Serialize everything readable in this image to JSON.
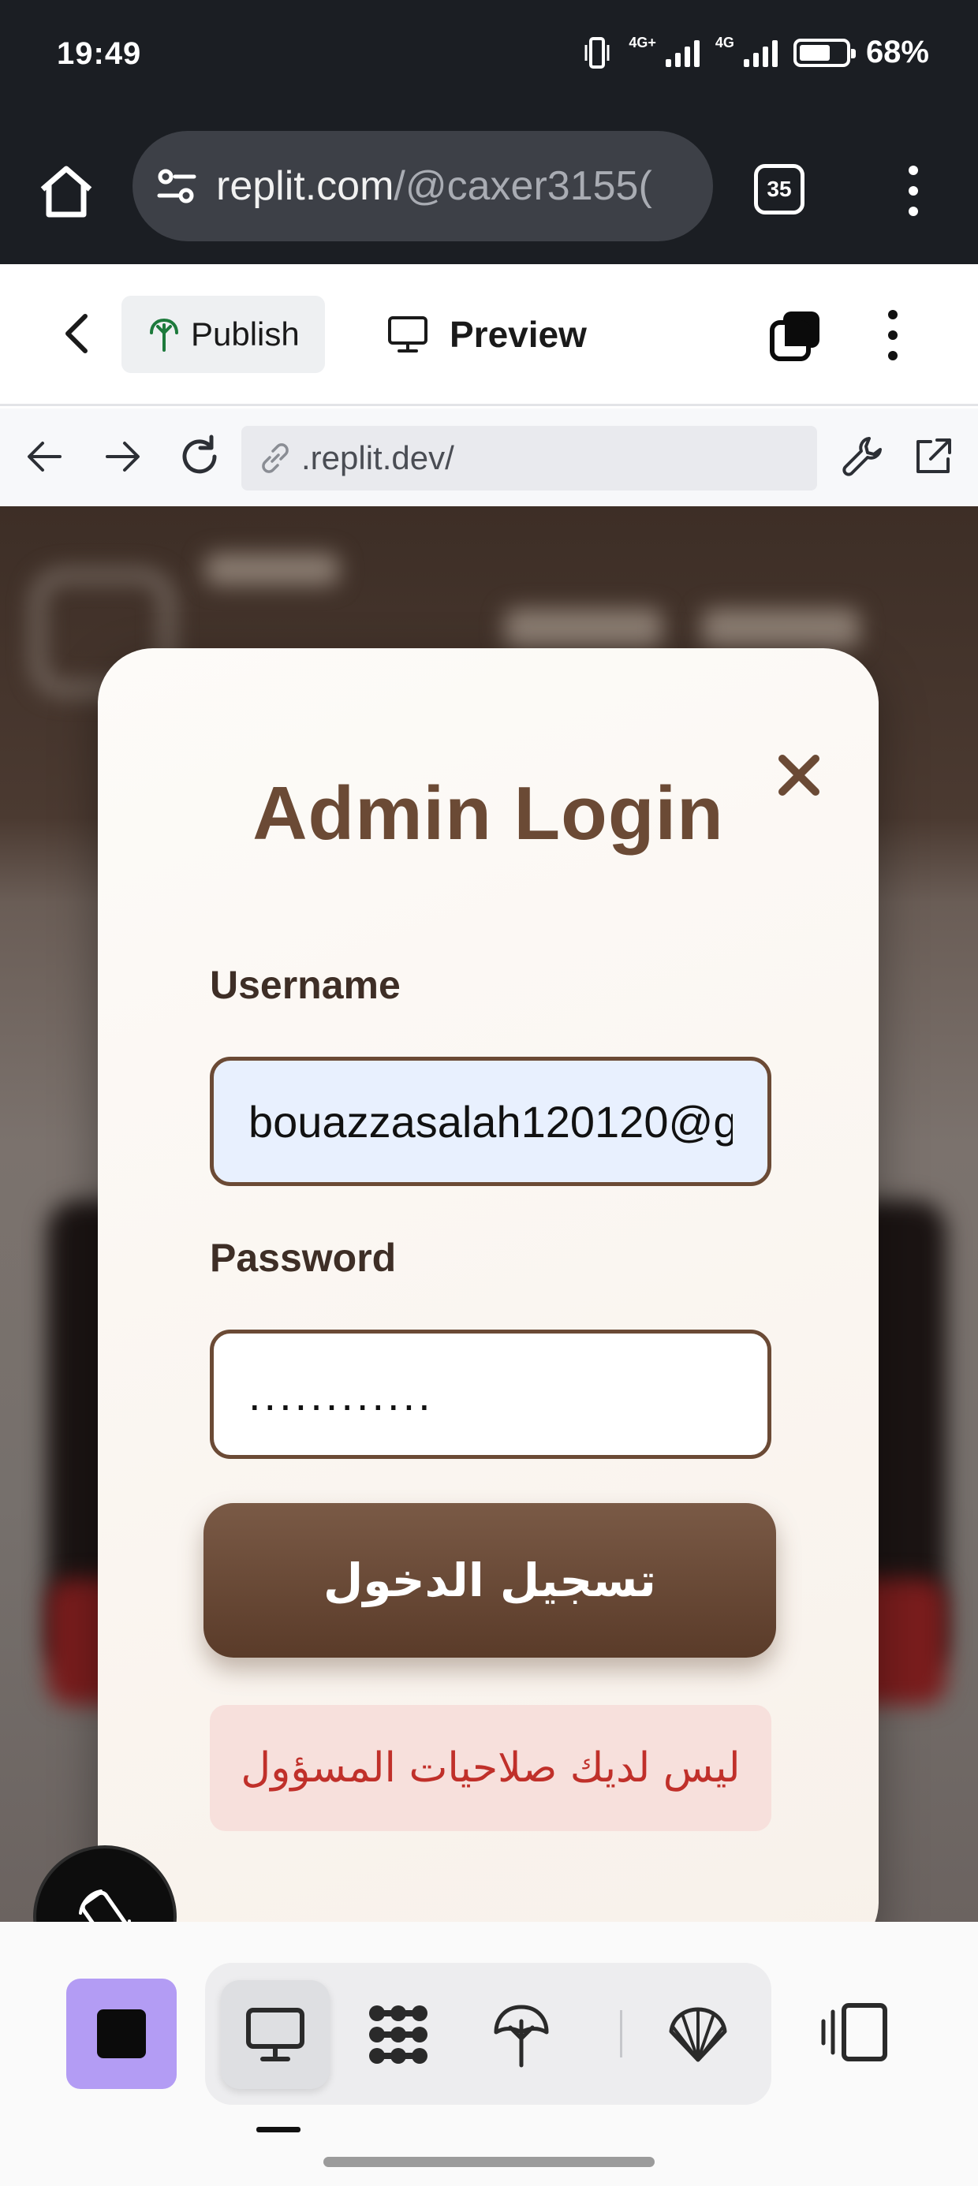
{
  "status_bar": {
    "time": "19:49",
    "network_1": "4G+",
    "network_2": "4G",
    "battery": "68%",
    "battery_level": 0.68
  },
  "browser": {
    "url_host": "replit.com",
    "url_path": "/@caxer3155(",
    "tab_count": "35"
  },
  "replit_toolbar": {
    "publish_label": "Publish",
    "preview_label": "Preview"
  },
  "webview": {
    "url": ".replit.dev/"
  },
  "login_modal": {
    "title": "Admin Login",
    "username_label": "Username",
    "username_value": "bouazzasalah120120@g",
    "password_label": "Password",
    "password_value": "............",
    "submit_label": "تسجيل الدخول",
    "error_message": "ليس لديك صلاحيات المسؤول"
  },
  "colors": {
    "brand_brown": "#6b4a35",
    "button_brown": "#5a3b29",
    "error_red": "#c0302a",
    "error_bg": "#f7e0dc",
    "stop_purple": "#b39cf4",
    "chrome_dark": "#1b1e23"
  },
  "icons": {
    "home": "home-icon",
    "site_settings": "tune-icon",
    "menu": "more-vert-icon",
    "back": "chevron-left-icon",
    "publish": "publish-icon",
    "preview": "monitor-icon",
    "layers": "layers-icon",
    "reload": "refresh-icon",
    "devtools": "wrench-icon",
    "open_external": "external-link-icon",
    "close": "close-icon",
    "rotate": "rotate-icon"
  }
}
